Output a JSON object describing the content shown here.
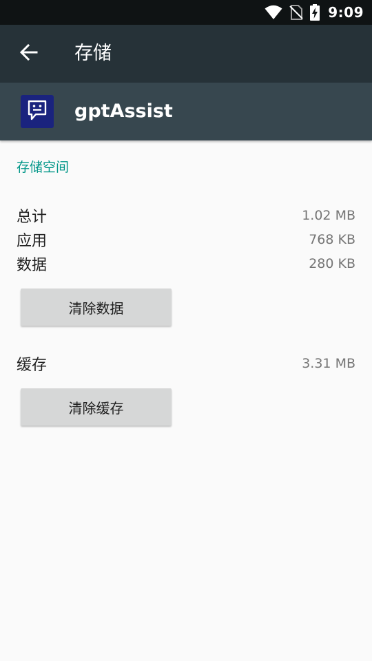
{
  "status_bar": {
    "time": "9:09",
    "icons": [
      "wifi-icon",
      "no-sim-icon",
      "battery-charging-icon"
    ]
  },
  "toolbar": {
    "title": "存储",
    "back_icon": "arrow-left-icon"
  },
  "app": {
    "name": "gptAssist",
    "icon": "chat-face-icon"
  },
  "storage": {
    "section_title": "存储空间",
    "rows": [
      {
        "label": "总计",
        "value": "1.02 MB"
      },
      {
        "label": "应用",
        "value": "768 KB"
      },
      {
        "label": "数据",
        "value": "280 KB"
      }
    ],
    "clear_data_label": "清除数据"
  },
  "cache": {
    "label": "缓存",
    "value": "3.31 MB",
    "clear_cache_label": "清除缓存"
  },
  "colors": {
    "status_bar": "#0f1314",
    "toolbar": "#263238",
    "app_header": "#37474f",
    "accent": "#009688",
    "app_icon_bg": "#1a237e",
    "background": "#fafafa",
    "button": "#d6d7d7"
  }
}
